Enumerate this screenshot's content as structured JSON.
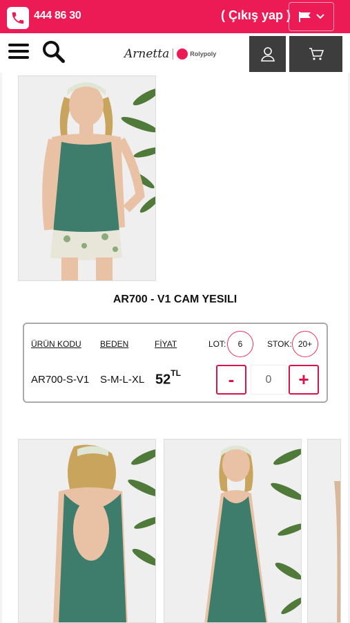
{
  "topbar": {
    "phone_icon": "phone-icon",
    "phone_number": "444 86 30",
    "logout_label": "( Çıkış yap )",
    "language_icon": "flag-icon"
  },
  "navbar": {
    "menu_icon": "hamburger-menu-icon",
    "search_icon": "search-icon",
    "brand_name": "Arnetta",
    "brand_sub": "Rolypoly",
    "user_icon": "user-icon",
    "cart_icon": "cart-icon"
  },
  "product": {
    "title": "AR700 - V1 CAM YESILI",
    "headers": {
      "code": "ÜRÜN KODU",
      "size": "BEDEN",
      "price": "FİYAT"
    },
    "lot_label": "LOT:",
    "lot_value": "6",
    "stock_label": "STOK:",
    "stock_value": "20+",
    "code": "AR700-S-V1",
    "sizes": "S-M-L-XL",
    "price": "52",
    "currency": "TL",
    "minus": "-",
    "plus": "+",
    "quantity": "0"
  },
  "colors": {
    "accent": "#ec1b55",
    "dark_button": "#3d3d3d",
    "garment": "#3e7d6b"
  }
}
